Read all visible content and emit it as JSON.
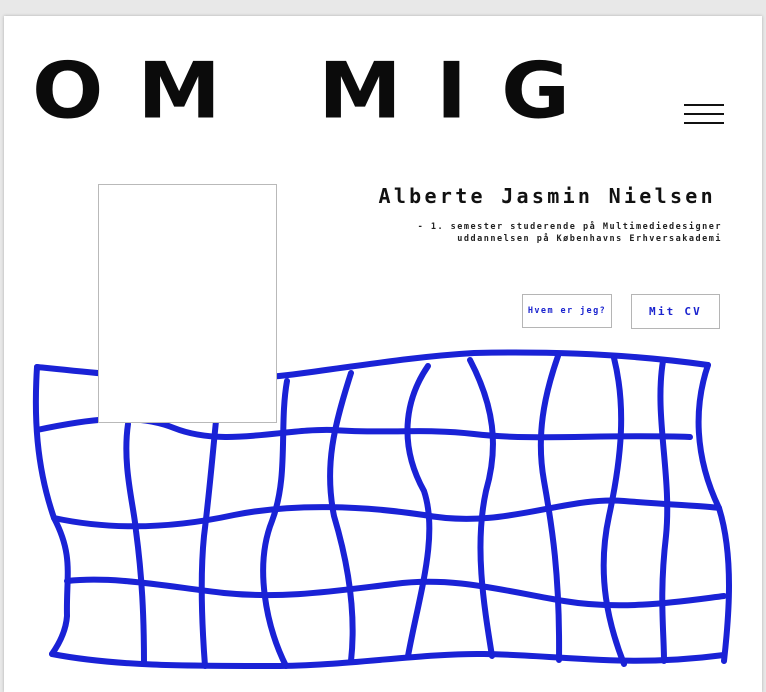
{
  "header": {
    "title": "OM MIG",
    "menu_icon": "hamburger-menu-icon"
  },
  "profile": {
    "name": "Alberte Jasmin Nielsen",
    "description_line1": "- 1. semester studerende på Multimediedesigner",
    "description_line2": "uddannelsen på Københavns Erhversakademi",
    "photo": "profile-photo-placeholder"
  },
  "buttons": {
    "who_label": "Hvem er jeg?",
    "cv_label": "Mit CV"
  },
  "decoration": {
    "grid_color": "#1a22d6",
    "icon": "wavy-grid-illustration"
  }
}
